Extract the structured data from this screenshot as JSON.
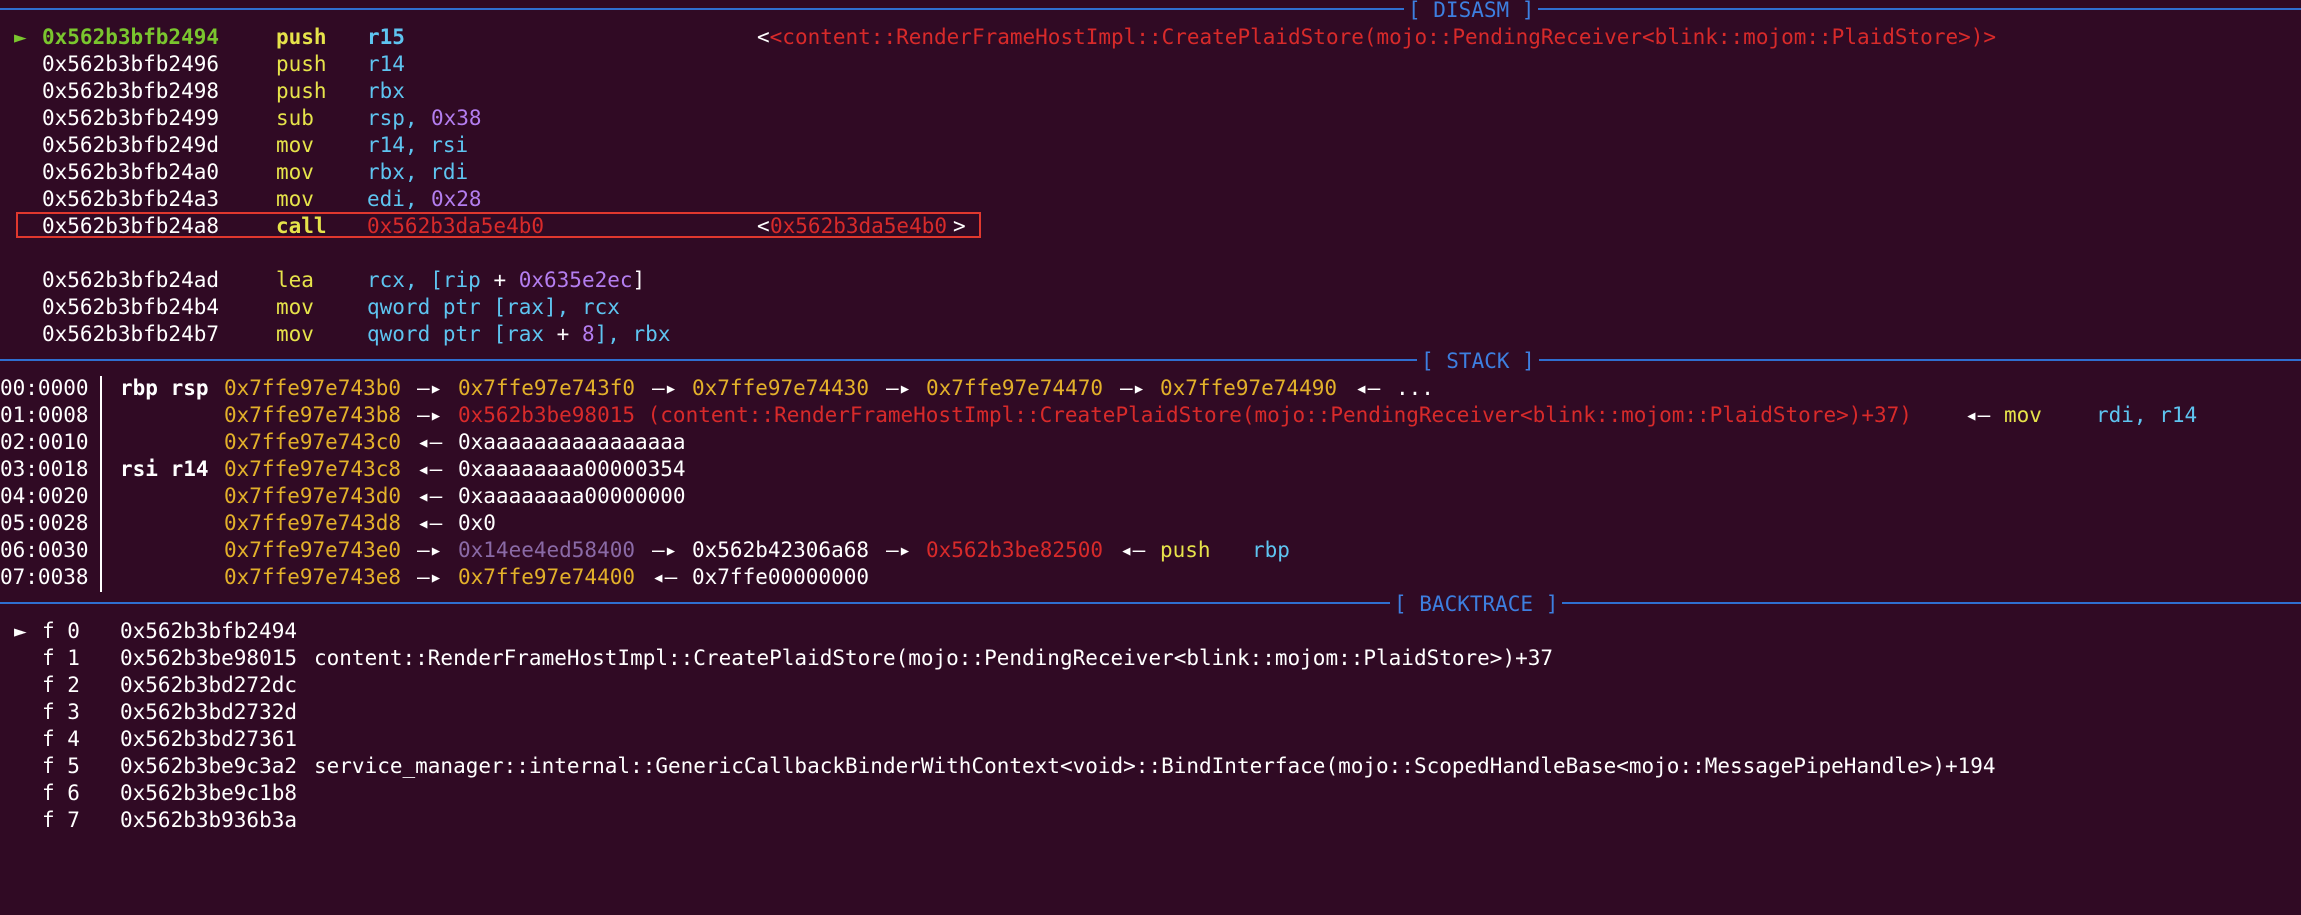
{
  "sections": {
    "disasm": "[ DISASM ]",
    "stack": "[ STACK ]",
    "backtrace": "[ BACKTRACE ]"
  },
  "disasm": {
    "rows": [
      {
        "marker": "►",
        "addr": "0x562b3bfb2494",
        "mnem": "push",
        "ops": "r15",
        "comment": "<content::RenderFrameHostImpl::CreatePlaidStore(mojo::PendingReceiver<blink::mojom::PlaidStore>)>"
      },
      {
        "addr": "0x562b3bfb2496",
        "mnem": "push",
        "ops": "r14"
      },
      {
        "addr": "0x562b3bfb2498",
        "mnem": "push",
        "ops": "rbx"
      },
      {
        "addr": "0x562b3bfb2499",
        "mnem": "sub",
        "op1": "rsp,",
        "op2": "0x38"
      },
      {
        "addr": "0x562b3bfb249d",
        "mnem": "mov",
        "ops": "r14, rsi"
      },
      {
        "addr": "0x562b3bfb24a0",
        "mnem": "mov",
        "ops": "rbx, rdi"
      },
      {
        "addr": "0x562b3bfb24a3",
        "mnem": "mov",
        "op1": "edi,",
        "op2": "0x28"
      },
      {
        "addr": "0x562b3bfb24a8",
        "mnem": "call",
        "ops": "0x562b3da5e4b0",
        "comment_open": "<",
        "comment_val": "0x562b3da5e4b0",
        "comment_close": ">"
      },
      {
        "addr": "0x562b3bfb24ad",
        "mnem": "lea",
        "a": "rcx, [",
        "b": "rip",
        "c": " + ",
        "d": "0x635e2ec",
        "e": "]"
      },
      {
        "addr": "0x562b3bfb24b4",
        "mnem": "mov",
        "a": "qword ptr [",
        "b": "rax",
        "c": "], rcx"
      },
      {
        "addr": "0x562b3bfb24b7",
        "mnem": "mov",
        "a": "qword ptr [",
        "b": "rax",
        "c": " + ",
        "d": "8",
        "e": "], rbx"
      }
    ]
  },
  "stack": {
    "rows": [
      {
        "off": "00:0000",
        "reg": "rbp rsp",
        "addr": "0x7ffe97e743b0",
        "chain": [
          "0x7ffe97e743f0",
          "0x7ffe97e74430",
          "0x7ffe97e74470",
          "0x7ffe97e74490"
        ],
        "tail": "...",
        "arrow": "—▸",
        "back": "◂—"
      },
      {
        "off": "01:0008",
        "addr": "0x7ffe97e743b8",
        "val": "0x562b3be98015 (content::RenderFrameHostImpl::CreatePlaidStore(mojo::PendingReceiver<blink::mojom::PlaidStore>)+37)",
        "ins": "mov",
        "ins_ops": "rdi, r14"
      },
      {
        "off": "02:0010",
        "addr": "0x7ffe97e743c0",
        "val": "0xaaaaaaaaaaaaaaaa"
      },
      {
        "off": "03:0018",
        "reg": "rsi r14",
        "addr": "0x7ffe97e743c8",
        "val": "0xaaaaaaaa00000354"
      },
      {
        "off": "04:0020",
        "addr": "0x7ffe97e743d0",
        "val": "0xaaaaaaaa00000000"
      },
      {
        "off": "05:0028",
        "addr": "0x7ffe97e743d8",
        "val": "0x0"
      },
      {
        "off": "06:0030",
        "addr": "0x7ffe97e743e0",
        "v1": "0x14ee4ed58400",
        "v2": "0x562b42306a68",
        "v3": "0x562b3be82500",
        "ins": "push",
        "ins_ops": "rbp"
      },
      {
        "off": "07:0038",
        "addr": "0x7ffe97e743e8",
        "v1": "0x7ffe97e74400",
        "v2": "0x7ffe00000000"
      }
    ]
  },
  "backtrace": {
    "rows": [
      {
        "marker": "►",
        "frame": "f 0",
        "addr": "0x562b3bfb2494",
        "sym": ""
      },
      {
        "frame": "f 1",
        "addr": "0x562b3be98015",
        "sym": "content::RenderFrameHostImpl::CreatePlaidStore(mojo::PendingReceiver<blink::mojom::PlaidStore>)+37"
      },
      {
        "frame": "f 2",
        "addr": "0x562b3bd272dc",
        "sym": ""
      },
      {
        "frame": "f 3",
        "addr": "0x562b3bd2732d",
        "sym": ""
      },
      {
        "frame": "f 4",
        "addr": "0x562b3bd27361",
        "sym": ""
      },
      {
        "frame": "f 5",
        "addr": "0x562b3be9c3a2",
        "sym": "service_manager::internal::GenericCallbackBinderWithContext<void>::BindInterface(mojo::ScopedHandleBase<mojo::MessagePipeHandle>)+194"
      },
      {
        "frame": "f 6",
        "addr": "0x562b3be9c1b8",
        "sym": ""
      },
      {
        "frame": "f 7",
        "addr": "0x562b3b936b3a",
        "sym": ""
      }
    ]
  }
}
